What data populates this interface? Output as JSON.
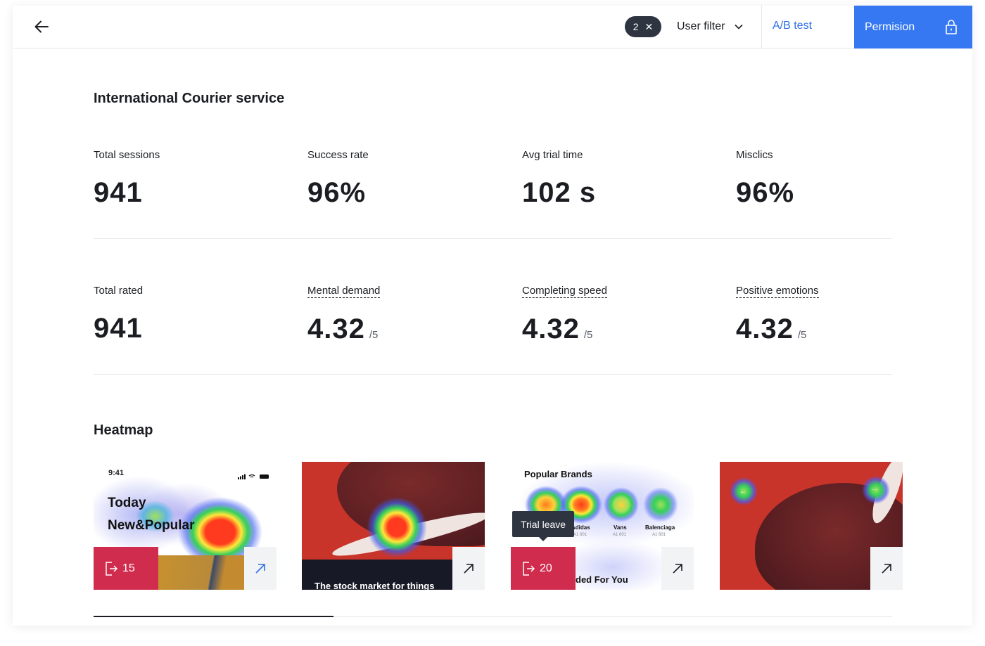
{
  "header": {
    "filter_count": "2",
    "user_filter_label": "User filter",
    "ab_test_label": "A/B test",
    "permission_label": "Permision"
  },
  "page": {
    "title": "International Courier service"
  },
  "stats_row1": [
    {
      "label": "Total sessions",
      "value": "941"
    },
    {
      "label": "Success rate",
      "value": "96%"
    },
    {
      "label": "Avg trial time",
      "value": "102 s"
    },
    {
      "label": "Misclics",
      "value": "96%"
    }
  ],
  "stats_row2": [
    {
      "label": "Total rated",
      "value": "941",
      "suffix": ""
    },
    {
      "label": "Mental demand",
      "value": "4.32",
      "suffix": "/5"
    },
    {
      "label": "Completing speed",
      "value": "4.32",
      "suffix": "/5"
    },
    {
      "label": "Positive emotions",
      "value": "4.32",
      "suffix": "/5"
    }
  ],
  "heatmap": {
    "title": "Heatmap",
    "progress": 0.3,
    "thumbs": [
      {
        "time": "9:41",
        "line1": "Today",
        "line2": "New&Popular",
        "leave_count": "15"
      },
      {
        "caption": "The stock market for things"
      },
      {
        "title": "Popular Brands",
        "brands": [
          "Adidas",
          "Vans",
          "Balenciaga"
        ],
        "brand_codes": [
          "A1 601",
          "A1 601",
          "A1 601"
        ],
        "footer_text": "ded For You",
        "leave_count": "20",
        "tooltip": "Trial leave"
      },
      {}
    ]
  },
  "colors": {
    "accent": "#3578f2",
    "leave": "#d02c4e",
    "dark": "#2e3440",
    "shoe_bg": "#c8342a"
  }
}
